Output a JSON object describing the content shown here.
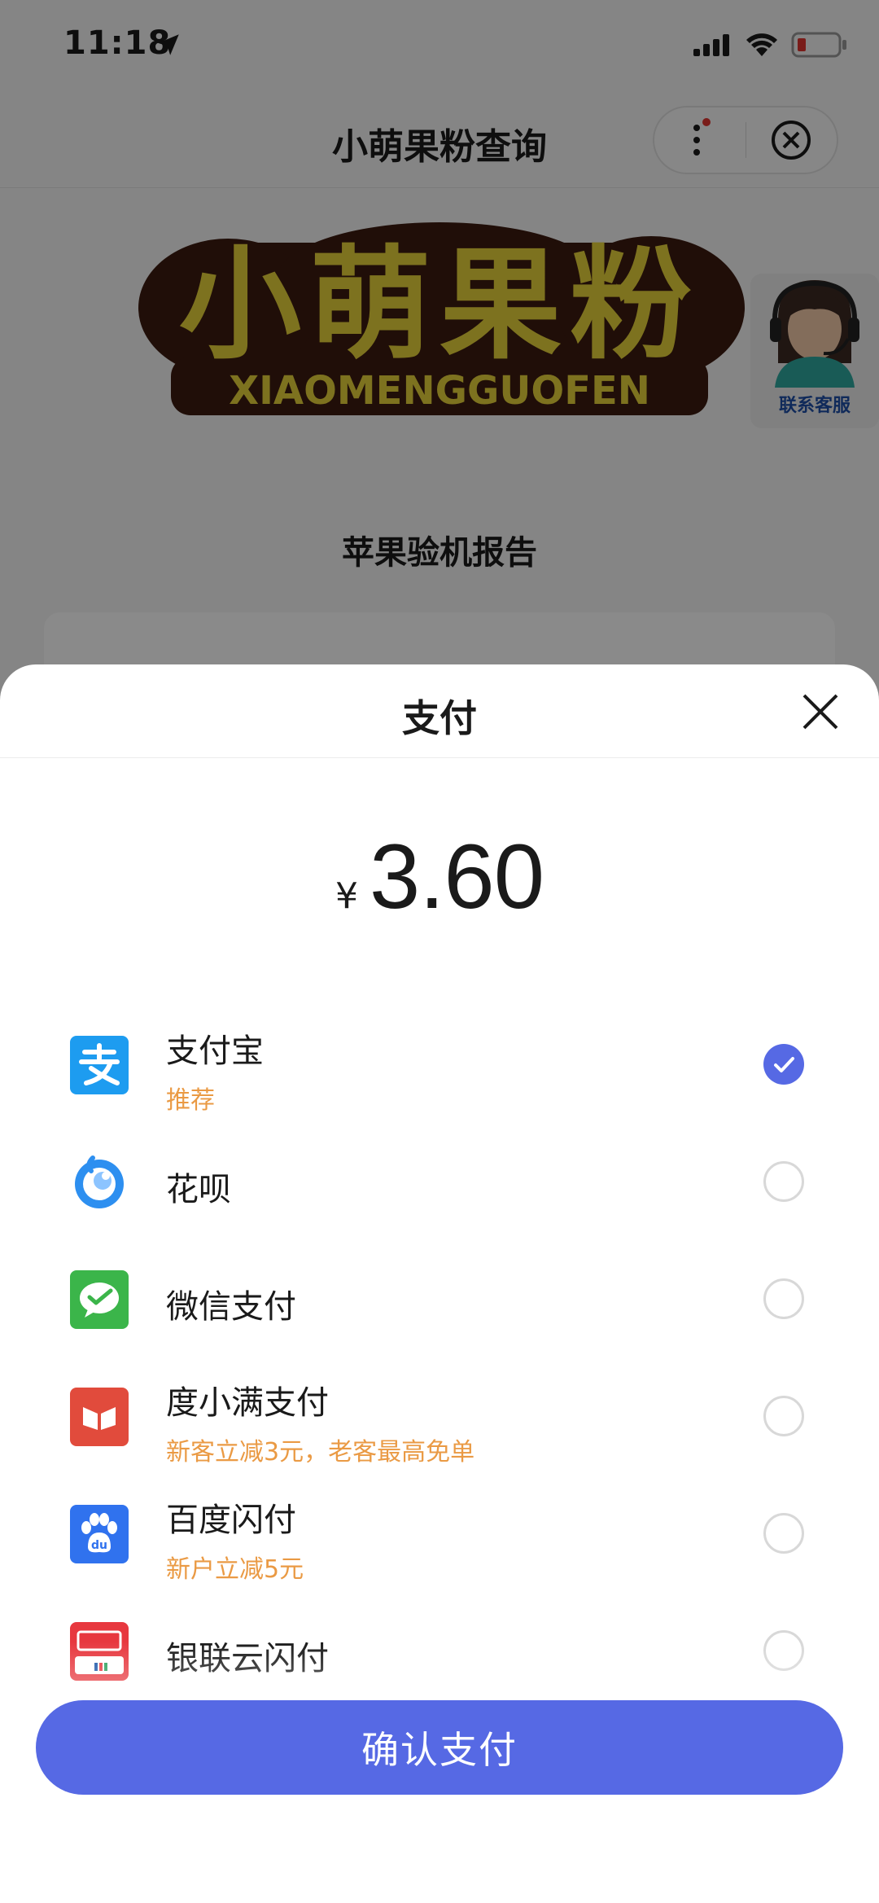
{
  "status_bar": {
    "time": "11:18"
  },
  "navbar": {
    "title": "小萌果粉查询"
  },
  "background": {
    "logo_text": "小萌果粉",
    "logo_subtext": "XIAOMENGGUOFEN",
    "customer_service_label": "联系客服",
    "report_title": "苹果验机报告"
  },
  "sheet": {
    "title": "支付",
    "currency_symbol": "¥",
    "amount": "3.60",
    "methods": [
      {
        "name": "支付宝",
        "subtitle": "推荐",
        "icon": "alipay-icon",
        "selected": true
      },
      {
        "name": "花呗",
        "subtitle": "",
        "icon": "huabei-icon",
        "selected": false
      },
      {
        "name": "微信支付",
        "subtitle": "",
        "icon": "wechat-pay-icon",
        "selected": false
      },
      {
        "name": "度小满支付",
        "subtitle": "新客立减3元，老客最高免单",
        "icon": "duxiaoman-icon",
        "selected": false
      },
      {
        "name": "百度闪付",
        "subtitle": "新户立减5元",
        "icon": "baidu-pay-icon",
        "selected": false
      },
      {
        "name": "银联云闪付",
        "subtitle": "",
        "icon": "unionpay-icon",
        "selected": false
      }
    ],
    "confirm_label": "确认支付"
  },
  "colors": {
    "accent": "#5669e4",
    "promo": "#ea9a44",
    "logo_brown": "#3c1a10",
    "logo_yellow": "#e8d23a"
  }
}
